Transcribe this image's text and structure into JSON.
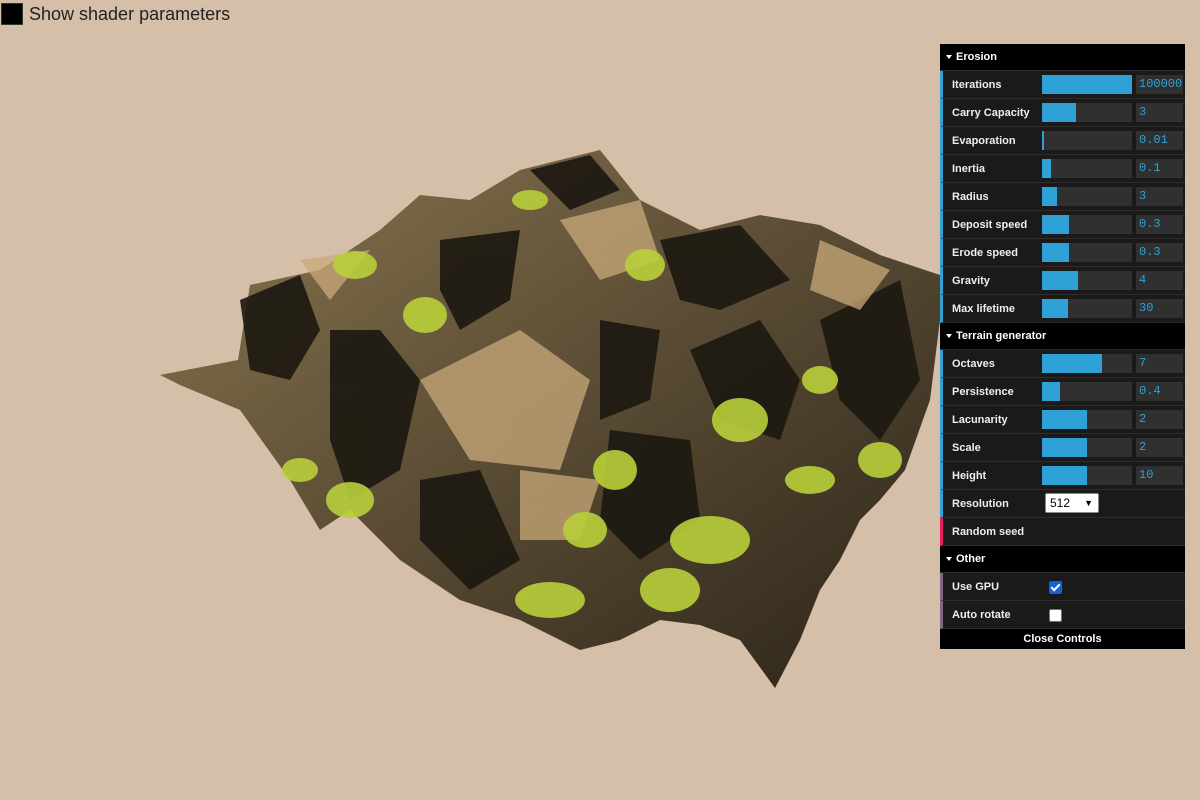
{
  "shader_toggle": {
    "label": "Show shader parameters"
  },
  "gui": {
    "erosion": {
      "title": "Erosion",
      "params": [
        {
          "name": "Iterations",
          "value": "100000",
          "fill": 1.0
        },
        {
          "name": "Carry Capacity",
          "value": "3",
          "fill": 0.38
        },
        {
          "name": "Evaporation",
          "value": "0.01",
          "fill": 0.01
        },
        {
          "name": "Inertia",
          "value": "0.1",
          "fill": 0.1
        },
        {
          "name": "Radius",
          "value": "3",
          "fill": 0.17
        },
        {
          "name": "Deposit speed",
          "value": "0.3",
          "fill": 0.3
        },
        {
          "name": "Erode speed",
          "value": "0.3",
          "fill": 0.3
        },
        {
          "name": "Gravity",
          "value": "4",
          "fill": 0.4
        },
        {
          "name": "Max lifetime",
          "value": "30",
          "fill": 0.29
        }
      ]
    },
    "terrain": {
      "title": "Terrain generator",
      "params": [
        {
          "name": "Octaves",
          "value": "7",
          "fill": 0.67
        },
        {
          "name": "Persistence",
          "value": "0.4",
          "fill": 0.2
        },
        {
          "name": "Lacunarity",
          "value": "2",
          "fill": 0.5
        },
        {
          "name": "Scale",
          "value": "2",
          "fill": 0.5
        },
        {
          "name": "Height",
          "value": "10",
          "fill": 0.5
        }
      ],
      "resolution": {
        "name": "Resolution",
        "value": "512"
      },
      "random_seed": "Random seed"
    },
    "other": {
      "title": "Other",
      "use_gpu": {
        "name": "Use GPU",
        "checked": true
      },
      "auto_rotate": {
        "name": "Auto rotate",
        "checked": false
      }
    },
    "close_label": "Close Controls"
  },
  "colors": {
    "accent": "#2fa1d6",
    "function": "#e61d5f",
    "boolean": "#806787",
    "background": "#d6bfa9"
  }
}
